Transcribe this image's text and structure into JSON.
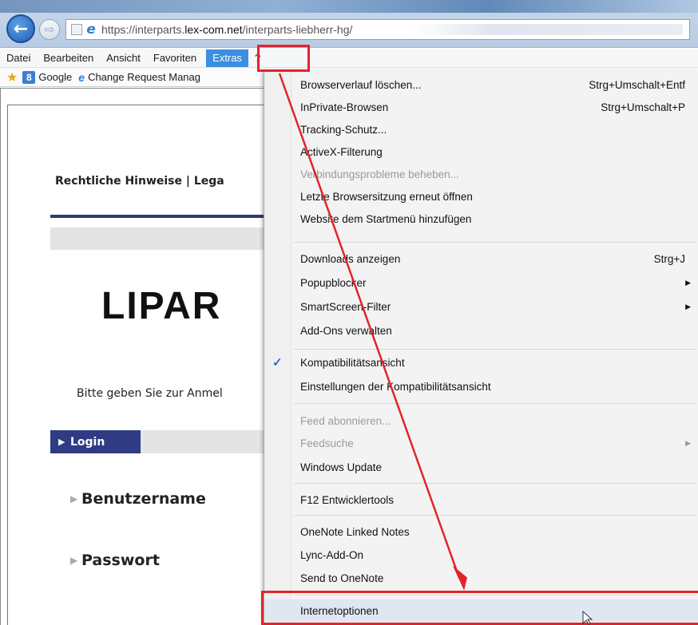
{
  "browser": {
    "address": {
      "scheme_prefix": "https://interparts.",
      "domain": "lex-com.net",
      "path": "/interparts-liebherr-hg/"
    }
  },
  "menubar": {
    "items": [
      "Datei",
      "Bearbeiten",
      "Ansicht",
      "Favoriten",
      "Extras",
      "?"
    ]
  },
  "favorites": {
    "google_icon": "8",
    "google_label": "Google",
    "cr_label": "Change Request Manag"
  },
  "page": {
    "legal_links": "Rechtliche Hinweise | Lega",
    "logo_text": "LIPAR",
    "login_hint": "Bitte geben Sie zur Anmel",
    "login_tab": "Login",
    "username_label": "Benutzername",
    "password_label": "Passwort"
  },
  "dropdown": {
    "items": [
      {
        "label": "Browserverlauf löschen...",
        "shortcut": "Strg+Umschalt+Entf"
      },
      {
        "label": "InPrivate-Browsen",
        "shortcut": "Strg+Umschalt+P"
      },
      {
        "label": "Tracking-Schutz...",
        "shortcut": ""
      },
      {
        "label": "ActiveX-Filterung",
        "shortcut": ""
      },
      {
        "label": "Verbindungsprobleme beheben...",
        "shortcut": ""
      },
      {
        "label": "Letzte Browsersitzung erneut öffnen",
        "shortcut": ""
      },
      {
        "label": "Website dem Startmenü hinzufügen",
        "shortcut": ""
      },
      {
        "label": "Downloads anzeigen",
        "shortcut": "Strg+J"
      },
      {
        "label": "Popupblocker",
        "shortcut": ""
      },
      {
        "label": "SmartScreen-Filter",
        "shortcut": ""
      },
      {
        "label": "Add-Ons verwalten",
        "shortcut": ""
      },
      {
        "label": "Kompatibilitätsansicht",
        "shortcut": ""
      },
      {
        "label": "Einstellungen der Kompatibilitätsansicht",
        "shortcut": ""
      },
      {
        "label": "Feed abonnieren...",
        "shortcut": ""
      },
      {
        "label": "Feedsuche",
        "shortcut": ""
      },
      {
        "label": "Windows Update",
        "shortcut": ""
      },
      {
        "label": "F12 Entwicklertools",
        "shortcut": ""
      },
      {
        "label": "OneNote Linked Notes",
        "shortcut": ""
      },
      {
        "label": "Lync-Add-On",
        "shortcut": ""
      },
      {
        "label": "Send to OneNote",
        "shortcut": ""
      },
      {
        "label": "Internetoptionen",
        "shortcut": ""
      }
    ]
  },
  "colors": {
    "highlight_blue": "#3b8ee0",
    "annotation_red": "#e3232b",
    "login_navy": "#2f3c84"
  }
}
